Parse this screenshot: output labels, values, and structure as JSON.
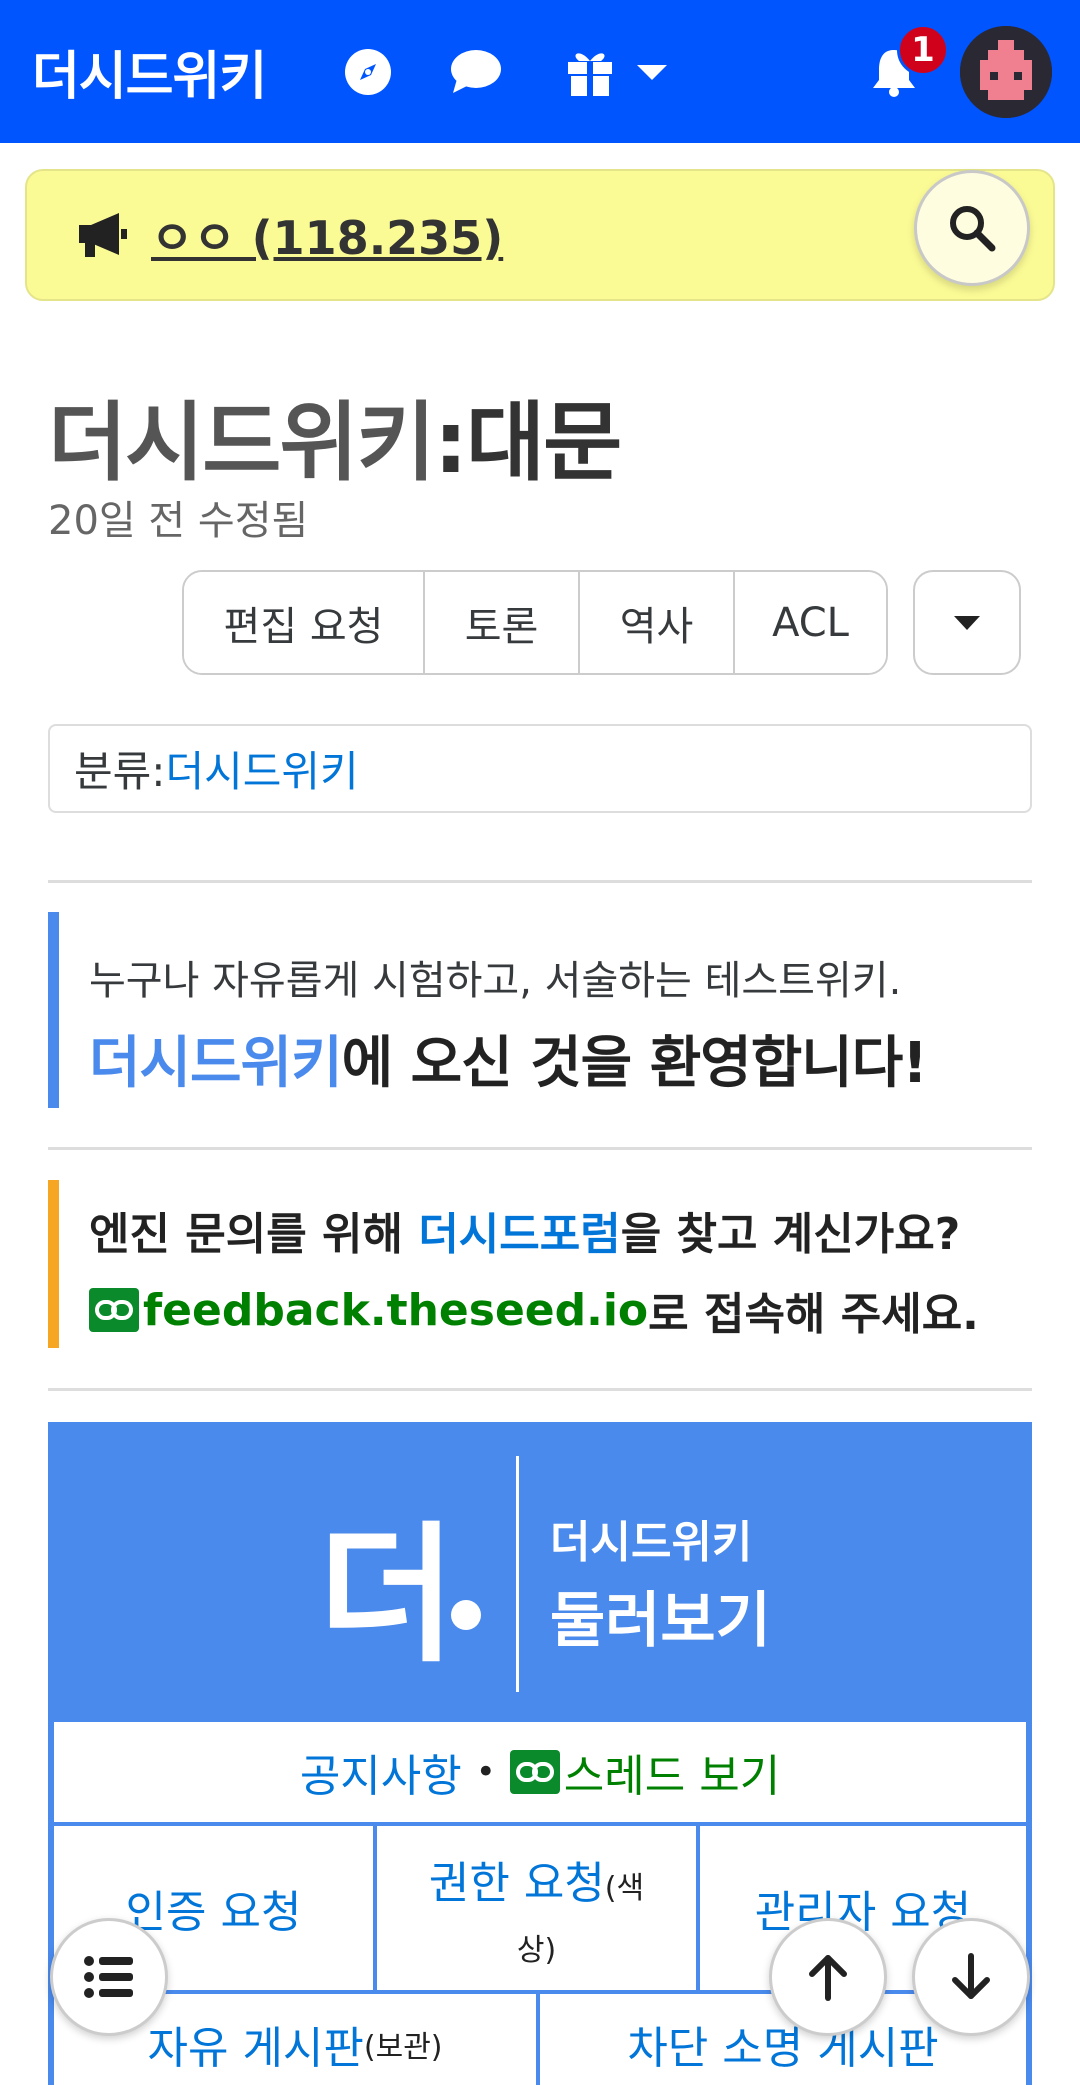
{
  "header": {
    "brand": "더시드위키",
    "notification_count": "1",
    "colors": {
      "bar": "#0055ff",
      "badge": "#d0021b"
    }
  },
  "search": {
    "label": "ㅇㅇ (118.235)"
  },
  "page": {
    "title_prefix": "더시드위키",
    "title_suffix": ":대문",
    "edited": "20일 전 수정됨",
    "actions": [
      "편집 요청",
      "토론",
      "역사",
      "ACL"
    ]
  },
  "category": {
    "label": "분류:",
    "link": "더시드위키"
  },
  "welcome": {
    "sub": "누구나 자유롭게 시험하고, 서술하는 테스트위키.",
    "highlight": "더시드위키",
    "rest": "에 오신 것을 환영합니다!"
  },
  "forum_notice": {
    "part1": "엔진 문의를 위해 ",
    "forum_link": "더시드포럼",
    "part2": "을 찾고 계신가요?",
    "ext_link": "feedback.theseed.io",
    "part3": "로 접속해 주세요."
  },
  "portal": {
    "logo": "더",
    "small_title": "더시드위키",
    "big_title": "둘러보기",
    "row1": {
      "notice": "공지사항",
      "sep": "•",
      "thread": "스레드 보기"
    },
    "row2": {
      "verify": "인증 요청",
      "perm": "권한 요청",
      "perm_note1": "(색",
      "perm_note2": "상)",
      "admin": "관리자 요청"
    },
    "row3": {
      "free": "자유 게시판",
      "free_note": "(보관)",
      "blocked": "차단 소명 게시판"
    }
  }
}
